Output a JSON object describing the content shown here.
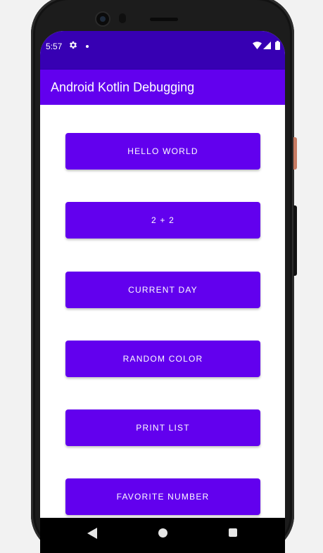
{
  "status_bar": {
    "time": "5:57",
    "icons": [
      "gear-icon",
      "dot-icon",
      "wifi-icon",
      "signal-icon",
      "battery-icon"
    ]
  },
  "app_bar": {
    "title": "Android Kotlin Debugging"
  },
  "buttons": [
    {
      "label": "HELLO WORLD"
    },
    {
      "label": "2 + 2"
    },
    {
      "label": "CURRENT DAY"
    },
    {
      "label": "RANDOM COLOR"
    },
    {
      "label": "PRINT LIST"
    },
    {
      "label": "FAVORITE NUMBER"
    }
  ],
  "nav_bar": {
    "icons": [
      "back-icon",
      "home-icon",
      "recents-icon"
    ]
  },
  "colors": {
    "status_bar": "#3700b3",
    "primary": "#6200ee",
    "on_primary": "#ffffff",
    "background": "#ffffff",
    "nav_bar": "#000000"
  }
}
